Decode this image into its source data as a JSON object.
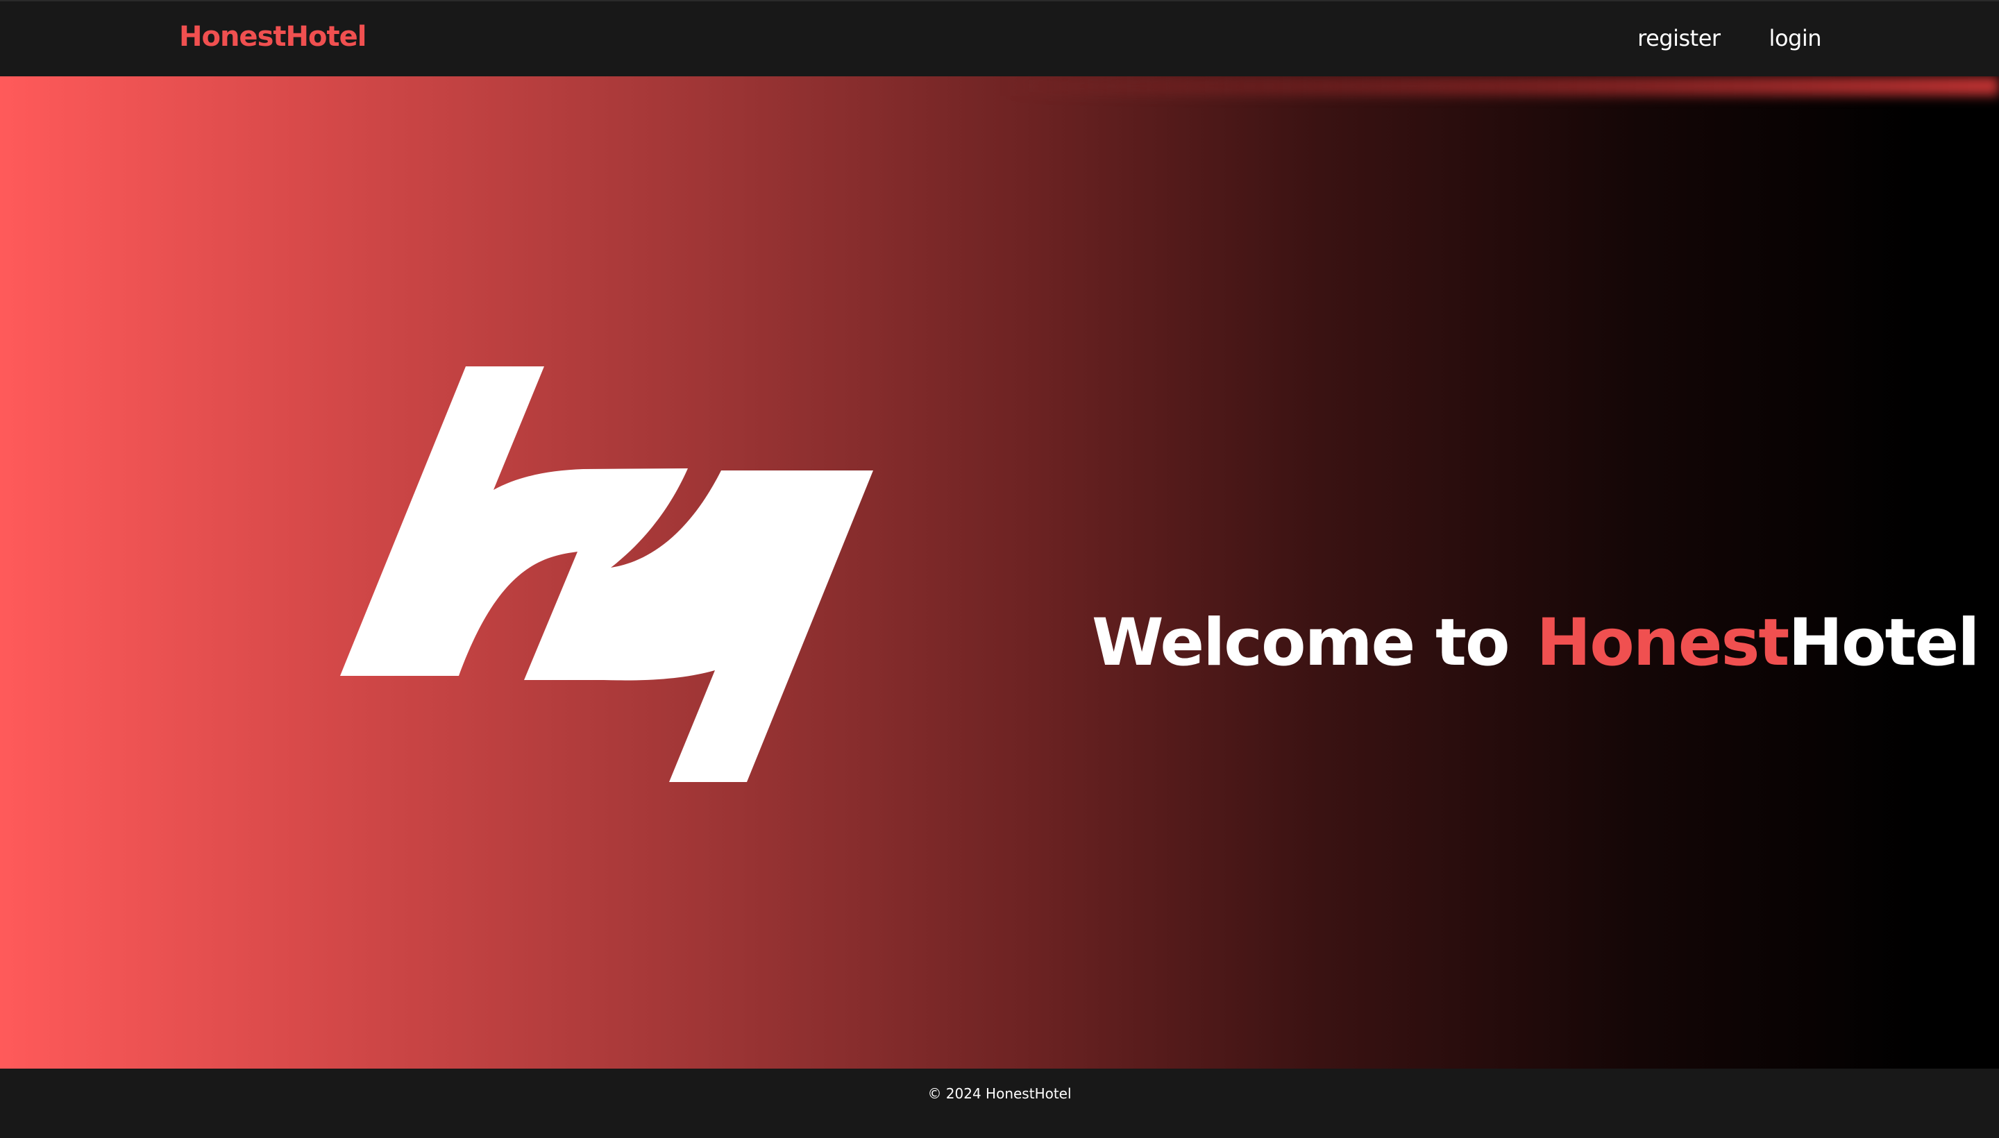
{
  "header": {
    "brand": "HonestHotel",
    "nav": [
      {
        "label": "register"
      },
      {
        "label": "login"
      }
    ]
  },
  "hero": {
    "welcome_prefix": "Welcome to",
    "brand_accent": "Honest",
    "brand_rest": "Hotel"
  },
  "footer": {
    "copyright": "© 2024 HonestHotel"
  },
  "colors": {
    "accent": "#f05050",
    "nav_bg": "#181818",
    "gradient_start": "#ff5a5a",
    "gradient_end": "#000000",
    "text": "#ffffff"
  },
  "icons": {
    "logo": "hh-logo-mark"
  }
}
